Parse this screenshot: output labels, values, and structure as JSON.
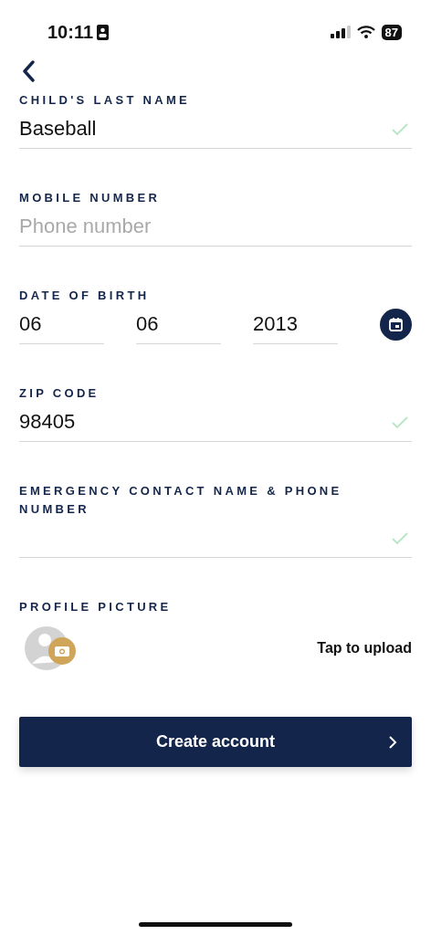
{
  "status_bar": {
    "time": "10:11",
    "battery": "87"
  },
  "fields": [
    {
      "kind": "text",
      "label": "CHILD'S LAST NAME",
      "value": "Baseball",
      "valid": true
    },
    {
      "kind": "text",
      "label": "MOBILE NUMBER",
      "placeholder": "Phone number",
      "valid": false
    },
    {
      "kind": "date",
      "label": "DATE OF BIRTH",
      "parts": [
        "06",
        "06",
        "2013"
      ]
    },
    {
      "kind": "text",
      "label": "ZIP CODE",
      "value": "98405",
      "valid": true
    },
    {
      "kind": "text",
      "label": "EMERGENCY CONTACT NAME & PHONE NUMBER",
      "valid": true
    }
  ],
  "profile_picture": {
    "label": "PROFILE PICTURE",
    "action": "Tap to upload"
  },
  "submit_button": {
    "label": "Create account"
  }
}
